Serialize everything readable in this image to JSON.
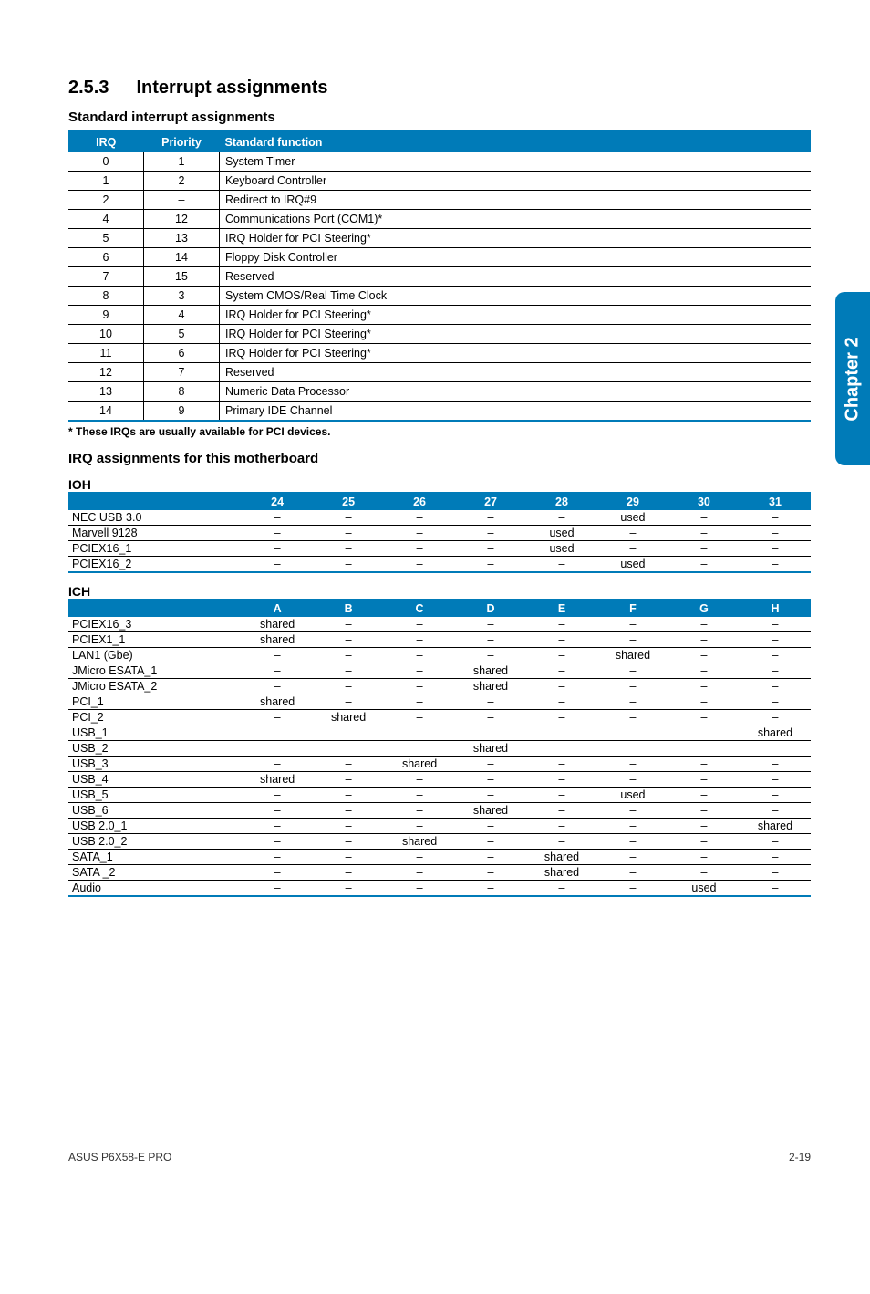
{
  "sidebar": "Chapter 2",
  "section": {
    "num": "2.5.3",
    "title": "Interrupt assignments"
  },
  "t1": {
    "heading": "Standard interrupt assignments",
    "cols": [
      "IRQ",
      "Priority",
      "Standard function"
    ],
    "rows": [
      {
        "irq": "0",
        "pri": "1",
        "fn": "System Timer"
      },
      {
        "irq": "1",
        "pri": "2",
        "fn": "Keyboard Controller"
      },
      {
        "irq": "2",
        "pri": "–",
        "fn": "Redirect to IRQ#9"
      },
      {
        "irq": "4",
        "pri": "12",
        "fn": "Communications Port (COM1)*"
      },
      {
        "irq": "5",
        "pri": "13",
        "fn": "IRQ Holder for PCI Steering*"
      },
      {
        "irq": "6",
        "pri": "14",
        "fn": "Floppy Disk Controller"
      },
      {
        "irq": "7",
        "pri": "15",
        "fn": "Reserved"
      },
      {
        "irq": "8",
        "pri": "3",
        "fn": "System CMOS/Real Time Clock"
      },
      {
        "irq": "9",
        "pri": "4",
        "fn": "IRQ Holder for PCI Steering*"
      },
      {
        "irq": "10",
        "pri": "5",
        "fn": "IRQ Holder for PCI Steering*"
      },
      {
        "irq": "11",
        "pri": "6",
        "fn": "IRQ Holder for PCI Steering*"
      },
      {
        "irq": "12",
        "pri": "7",
        "fn": "Reserved"
      },
      {
        "irq": "13",
        "pri": "8",
        "fn": "Numeric Data Processor"
      },
      {
        "irq": "14",
        "pri": "9",
        "fn": "Primary IDE Channel"
      }
    ],
    "note": "* These IRQs are usually available for PCI devices."
  },
  "t2": {
    "heading": "IRQ assignments for this motherboard",
    "sub1": "IOH",
    "cols1": [
      "",
      "24",
      "25",
      "26",
      "27",
      "28",
      "29",
      "30",
      "31"
    ],
    "rows1": [
      {
        "l": "NEC USB 3.0",
        "c": [
          "–",
          "–",
          "–",
          "–",
          "–",
          "used",
          "–",
          "–"
        ]
      },
      {
        "l": "Marvell 9128",
        "c": [
          "–",
          "–",
          "–",
          "–",
          "used",
          "–",
          "–",
          "–"
        ]
      },
      {
        "l": "PCIEX16_1",
        "c": [
          "–",
          "–",
          "–",
          "–",
          "used",
          "–",
          "–",
          "–"
        ]
      },
      {
        "l": "PCIEX16_2",
        "c": [
          "–",
          "–",
          "–",
          "–",
          "–",
          "used",
          "–",
          "–"
        ]
      }
    ],
    "sub2": "ICH",
    "cols2": [
      "",
      "A",
      "B",
      "C",
      "D",
      "E",
      "F",
      "G",
      "H"
    ],
    "rows2": [
      {
        "l": "PCIEX16_3",
        "c": [
          "shared",
          "–",
          "–",
          "–",
          "–",
          "–",
          "–",
          "–"
        ]
      },
      {
        "l": "PCIEX1_1",
        "c": [
          "shared",
          "–",
          "–",
          "–",
          "–",
          "–",
          "–",
          "–"
        ]
      },
      {
        "l": "LAN1 (Gbe)",
        "c": [
          "–",
          "–",
          "–",
          "–",
          "–",
          "shared",
          "–",
          "–"
        ]
      },
      {
        "l": "JMicro ESATA_1",
        "c": [
          "–",
          "–",
          "–",
          "shared",
          "–",
          "–",
          "–",
          "–"
        ]
      },
      {
        "l": "JMicro ESATA_2",
        "c": [
          "–",
          "–",
          "–",
          "shared",
          "–",
          "–",
          "–",
          "–"
        ]
      },
      {
        "l": "PCI_1",
        "c": [
          "shared",
          "–",
          "–",
          "–",
          "–",
          "–",
          "–",
          "–"
        ]
      },
      {
        "l": "PCI_2",
        "c": [
          "–",
          "shared",
          "–",
          "–",
          "–",
          "–",
          "–",
          "–"
        ]
      },
      {
        "l": "USB_1",
        "c": [
          "",
          "",
          "",
          "",
          "",
          "",
          "",
          "shared"
        ]
      },
      {
        "l": "USB_2",
        "c": [
          "",
          "",
          "",
          "shared",
          "",
          "",
          "",
          ""
        ]
      },
      {
        "l": "USB_3",
        "c": [
          "–",
          "–",
          "shared",
          "–",
          "–",
          "–",
          "–",
          "–"
        ]
      },
      {
        "l": "USB_4",
        "c": [
          "shared",
          "–",
          "–",
          "–",
          "–",
          "–",
          "–",
          "–"
        ]
      },
      {
        "l": "USB_5",
        "c": [
          "–",
          "–",
          "–",
          "–",
          "–",
          "used",
          "–",
          "–"
        ]
      },
      {
        "l": "USB_6",
        "c": [
          "–",
          "–",
          "–",
          "shared",
          "–",
          "–",
          "–",
          "–"
        ]
      },
      {
        "l": "USB 2.0_1",
        "c": [
          "–",
          "–",
          "–",
          "–",
          "–",
          "–",
          "–",
          "shared"
        ]
      },
      {
        "l": "USB 2.0_2",
        "c": [
          "–",
          "–",
          "shared",
          "–",
          "–",
          "–",
          "–",
          "–"
        ]
      },
      {
        "l": "SATA_1",
        "c": [
          "–",
          "–",
          "–",
          "–",
          "shared",
          "–",
          "–",
          "–"
        ]
      },
      {
        "l": "SATA _2",
        "c": [
          "–",
          "–",
          "–",
          "–",
          "shared",
          "–",
          "–",
          "–"
        ]
      },
      {
        "l": "Audio",
        "c": [
          "–",
          "–",
          "–",
          "–",
          "–",
          "–",
          "used",
          "–"
        ]
      }
    ]
  },
  "footer": {
    "left": "ASUS P6X58-E PRO",
    "right": "2-19"
  }
}
